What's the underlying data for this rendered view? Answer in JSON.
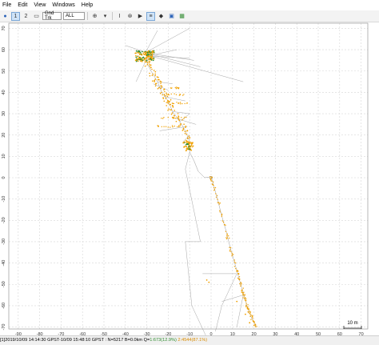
{
  "menu": [
    "File",
    "Edit",
    "View",
    "Windows",
    "Help"
  ],
  "toolbar": {
    "btn1": "1",
    "btn2": "2",
    "plot_type": "Gnd Trk",
    "filter": "ALL",
    "colors": {
      "active_bg": "#cfe3f7",
      "icon_blue": "#2a62b8",
      "icon_green": "#2e8b2e"
    }
  },
  "plot": {
    "x_ticks": [
      "-90",
      "-80",
      "-70",
      "-60",
      "-50",
      "-40",
      "-30",
      "-20",
      "-10",
      "0",
      "10",
      "20",
      "30",
      "40",
      "50",
      "60",
      "70"
    ],
    "y_ticks": [
      "70",
      "60",
      "50",
      "40",
      "30",
      "20",
      "10",
      "0",
      "-10",
      "-20",
      "-30",
      "-40",
      "-50",
      "-60",
      "-70"
    ],
    "scale_label": "10 m",
    "colors": {
      "grid": "#d6d6d6",
      "fix": "#2e8b2e",
      "float": "#f0a000",
      "track": "#9a9a9a",
      "axis": "#888888"
    }
  },
  "status": {
    "main": "[1]2019/10/09 14:14:30 GPST-10/09 15:48:10 GPST : N=5217 B=0.0km Q=",
    "q1": "1:673(12.9%)",
    "q2": "2:4544(87.1%)"
  }
}
